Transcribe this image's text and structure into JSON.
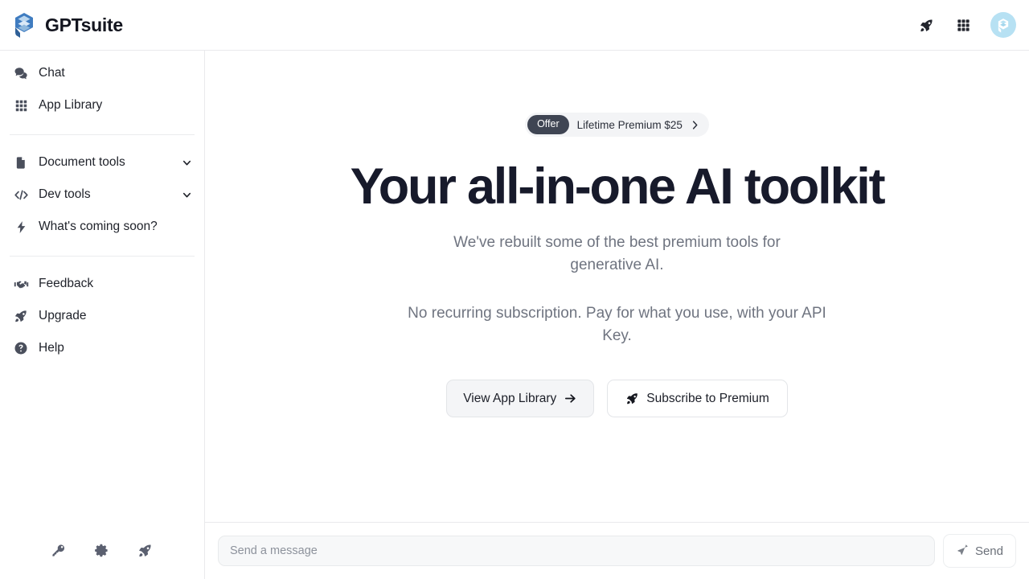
{
  "app": {
    "name": "GPTsuite",
    "logo_icon": "cube-stack-chat-logo"
  },
  "header": {
    "actions": [
      {
        "name": "rocket-icon",
        "label": "Upgrade"
      },
      {
        "name": "grid-icon",
        "label": "App Library"
      }
    ],
    "avatar": {
      "icon": "user-avatar",
      "bg": "#b7e1f3"
    }
  },
  "sidebar": {
    "primary": [
      {
        "label": "Chat",
        "icon": "chat-bubbles-icon",
        "expandable": false
      },
      {
        "label": "App Library",
        "icon": "grid-icon",
        "expandable": false
      }
    ],
    "tools": [
      {
        "label": "Document tools",
        "icon": "document-icon",
        "expandable": true,
        "chevron": "chevron-down-icon"
      },
      {
        "label": "Dev tools",
        "icon": "code-brackets-icon",
        "expandable": true,
        "chevron": "chevron-down-icon"
      },
      {
        "label": "What's coming soon?",
        "icon": "lightning-bolt-icon",
        "expandable": false
      }
    ],
    "secondary": [
      {
        "label": "Feedback",
        "icon": "handshake-icon"
      },
      {
        "label": "Upgrade",
        "icon": "rocket-icon"
      },
      {
        "label": "Help",
        "icon": "question-circle-icon"
      }
    ],
    "footer_icons": [
      {
        "name": "key-icon",
        "label": "API Key"
      },
      {
        "name": "gear-icon",
        "label": "Settings"
      },
      {
        "name": "rocket-icon",
        "label": "Upgrade"
      }
    ]
  },
  "hero": {
    "offer": {
      "badge": "Offer",
      "text": "Lifetime Premium $25",
      "chevron": "chevron-right-icon"
    },
    "title": "Your all-in-one AI toolkit",
    "paragraph_1": "We've rebuilt some of the best premium tools for generative AI.",
    "paragraph_2": "No recurring subscription. Pay for what you use, with your API Key.",
    "cta_primary": {
      "label": "View App Library",
      "icon": "arrow-right-icon"
    },
    "cta_secondary": {
      "label": "Subscribe to Premium",
      "icon": "rocket-icon"
    }
  },
  "composer": {
    "placeholder": "Send a message",
    "value": "",
    "send_label": "Send",
    "send_icon": "paper-plane-icon"
  },
  "colors": {
    "brand_blue": "#3f7cc0",
    "heading": "#171a2b",
    "muted_text": "#6f7480",
    "badge_dark": "#3f4553",
    "avatar_blue": "#b7e1f3",
    "border": "#e9eaec"
  }
}
